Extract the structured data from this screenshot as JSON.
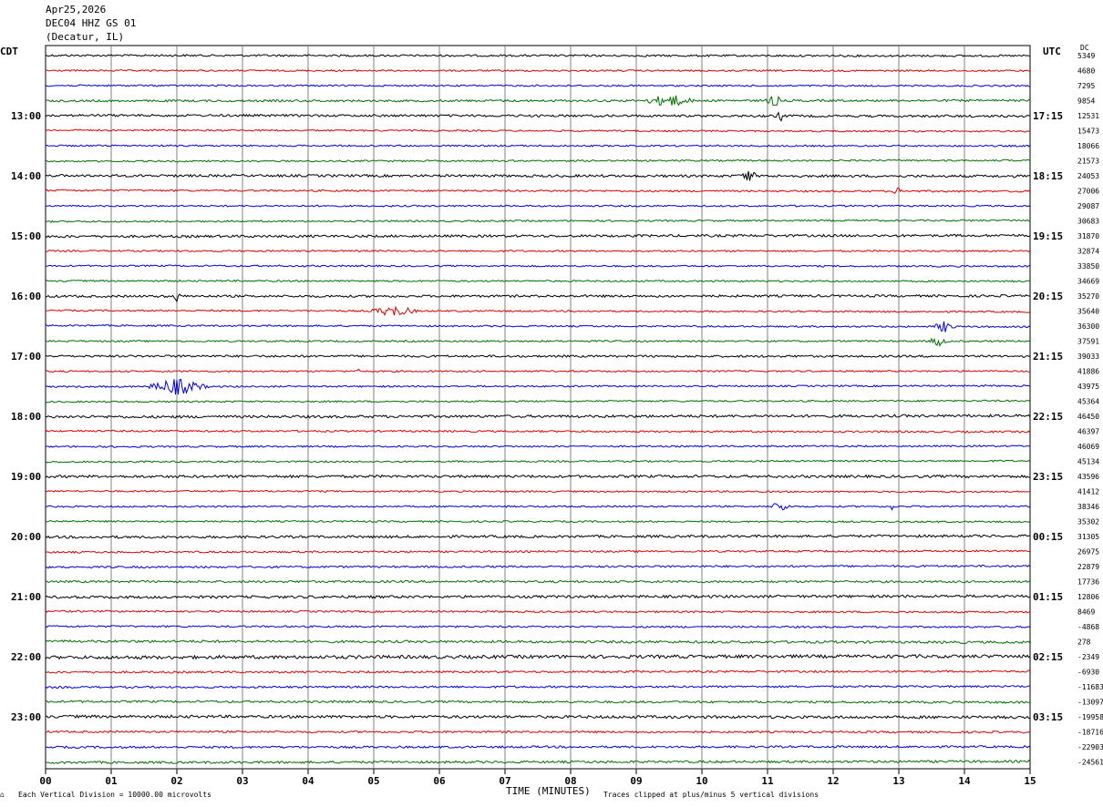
{
  "header": {
    "date": "Apr25,2026",
    "station": "DEC04 HHZ GS 01",
    "location": "(Decatur, IL)"
  },
  "labels": {
    "left_tz": "CDT",
    "right_tz": "UTC",
    "dc_label": "DC"
  },
  "footer": {
    "scale_note": "Each Vertical Division = 10000.00 microvolts",
    "clip_note": "Traces clipped at plus/minus 5 vertical divisions"
  },
  "chart_data": {
    "type": "line",
    "title": "",
    "xlabel": "TIME (MINUTES)",
    "ylabel": "",
    "xlim": [
      0,
      15
    ],
    "x_ticks": [
      "00",
      "01",
      "02",
      "03",
      "04",
      "05",
      "06",
      "07",
      "08",
      "09",
      "10",
      "11",
      "12",
      "13",
      "14",
      "15"
    ],
    "grid": true,
    "trace_colors": [
      "#000000",
      "#e00000",
      "#0000e0",
      "#007000"
    ],
    "left_hour_labels": [
      "13:00",
      "14:00",
      "15:00",
      "16:00",
      "17:00",
      "18:00",
      "19:00",
      "20:00",
      "21:00",
      "22:00",
      "23:00"
    ],
    "right_hour_labels": [
      "17:15",
      "18:15",
      "19:15",
      "20:15",
      "21:15",
      "22:15",
      "23:15",
      "00:15",
      "01:15",
      "02:15",
      "03:15"
    ],
    "dc_offsets": [
      "5349",
      "4680",
      "7295",
      "9854",
      "12531",
      "15473",
      "18066",
      "21573",
      "24053",
      "27006",
      "29087",
      "30683",
      "31870",
      "32874",
      "33850",
      "34669",
      "35270",
      "35640",
      "36300",
      "37591",
      "39033",
      "41886",
      "43975",
      "45364",
      "46450",
      "46397",
      "46069",
      "45134",
      "43596",
      "41412",
      "38346",
      "35302",
      "31305",
      "26975",
      "22879",
      "17736",
      "12806",
      "8469",
      "-4868",
      "278",
      "-2349",
      "-6930",
      "-11683",
      "-13097",
      "-19958",
      "-18716",
      "-22903",
      "-24561"
    ],
    "events": [
      {
        "row": 3,
        "minute": 9.5,
        "amp": 3,
        "len": 0.4
      },
      {
        "row": 3,
        "minute": 11.1,
        "amp": 2.5,
        "len": 0.15
      },
      {
        "row": 4,
        "minute": 11.2,
        "amp": 2,
        "len": 0.1
      },
      {
        "row": 8,
        "minute": 10.7,
        "amp": 3,
        "len": 0.15
      },
      {
        "row": 9,
        "minute": 13.0,
        "amp": 2,
        "len": 0.1
      },
      {
        "row": 16,
        "minute": 2.0,
        "amp": 3.5,
        "len": 0.05
      },
      {
        "row": 17,
        "minute": 5.3,
        "amp": 2.5,
        "len": 0.4
      },
      {
        "row": 18,
        "minute": 13.7,
        "amp": 2.5,
        "len": 0.2
      },
      {
        "row": 19,
        "minute": 13.6,
        "amp": 2.5,
        "len": 0.15
      },
      {
        "row": 21,
        "minute": 4.8,
        "amp": 3,
        "len": 0.05
      },
      {
        "row": 22,
        "minute": 2.0,
        "amp": 4,
        "len": 0.5
      },
      {
        "row": 30,
        "minute": 11.2,
        "amp": 3,
        "len": 0.15
      },
      {
        "row": 30,
        "minute": 12.9,
        "amp": 3,
        "len": 0.04
      }
    ],
    "row_noise": [
      1.2,
      1.0,
      1.0,
      1.3,
      1.4,
      1.0,
      1.0,
      1.0,
      1.5,
      1.1,
      1.0,
      1.0,
      1.5,
      1.0,
      1.0,
      1.0,
      1.4,
      1.0,
      1.0,
      1.0,
      1.3,
      1.0,
      1.0,
      1.0,
      1.6,
      1.1,
      1.0,
      1.0,
      1.6,
      1.0,
      1.0,
      1.0,
      1.5,
      1.1,
      1.2,
      1.3,
      1.6,
      1.1,
      1.1,
      1.5,
      2.0,
      1.2,
      1.2,
      1.3,
      1.7,
      1.2,
      1.3,
      1.4
    ]
  }
}
